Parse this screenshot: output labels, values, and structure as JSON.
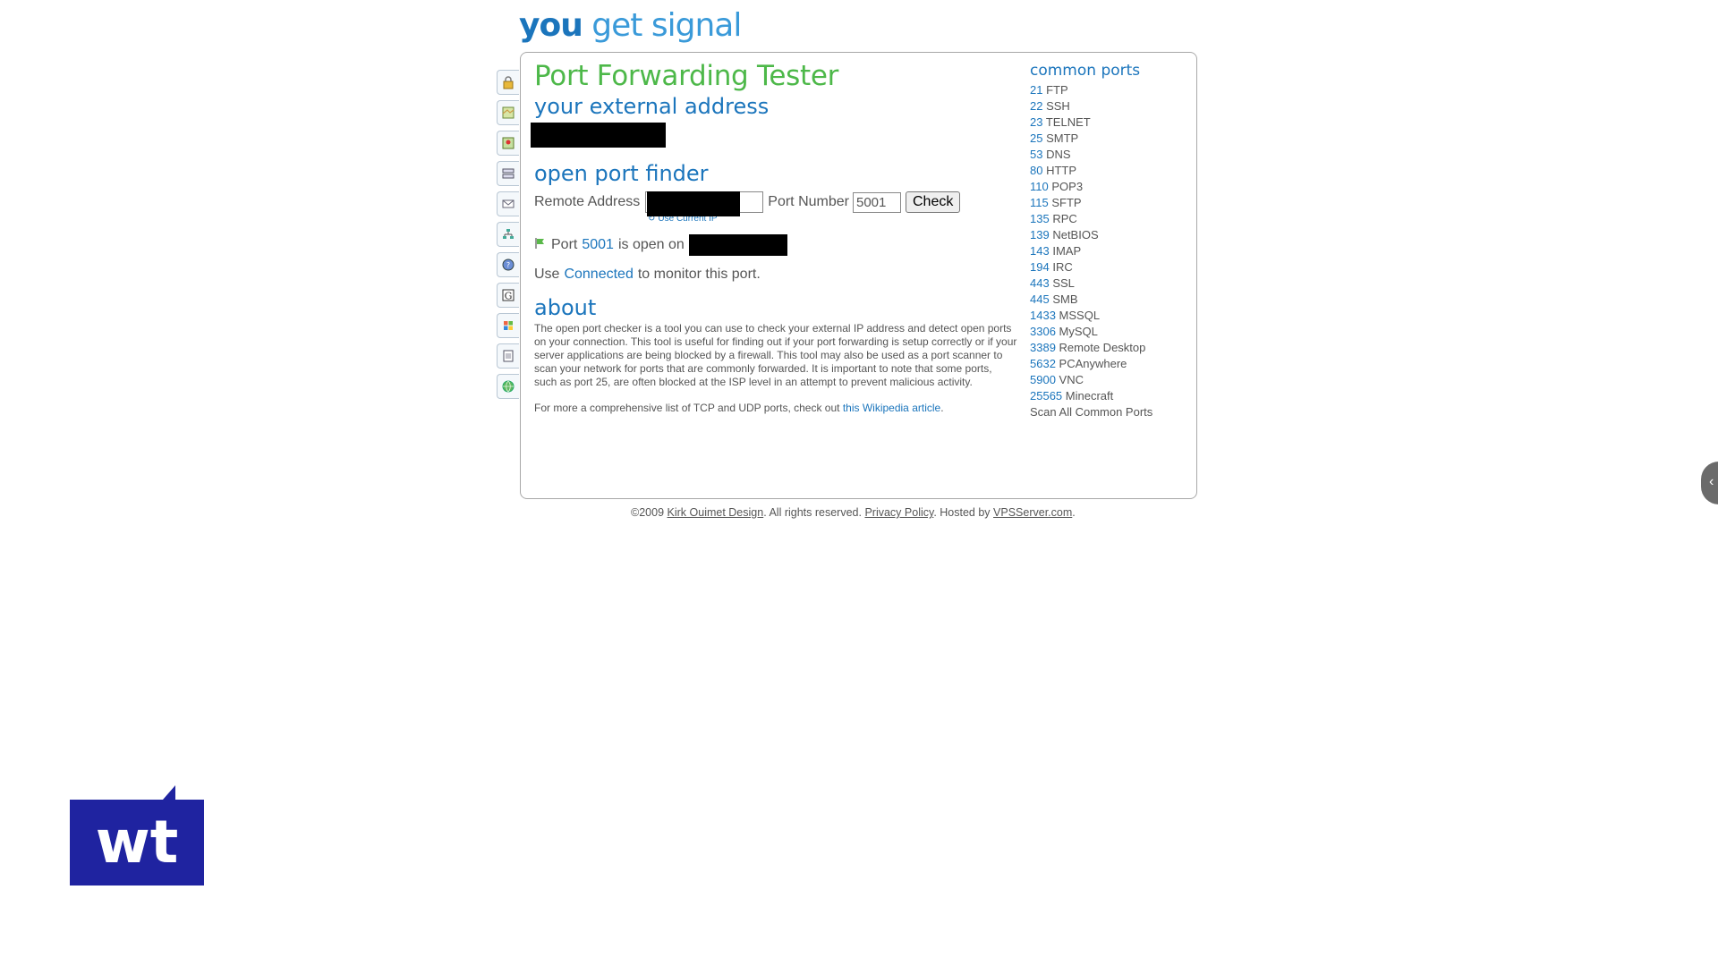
{
  "logo": {
    "part1": "you",
    "part2": "get signal"
  },
  "sidebar": {
    "icons": [
      "lock-icon",
      "map-icon",
      "map-location-icon",
      "server-icon",
      "mail-icon",
      "network-icon",
      "whois-icon",
      "google-icon",
      "windows-icon",
      "document-icon",
      "globe-icon"
    ]
  },
  "main": {
    "title": "Port Forwarding Tester",
    "external_heading": "your external address",
    "finder_heading": "open port finder",
    "remote_address_label": "Remote Address",
    "port_number_label": "Port Number",
    "port_number_value": "5001",
    "check_button": "Check",
    "use_current_ip": "Use Current IP",
    "result": {
      "prefix": "Port",
      "port": "5001",
      "suffix": "is open on"
    },
    "connected": {
      "prefix": "Use",
      "link": "Connected",
      "suffix": "to monitor this port."
    },
    "about_heading": "about",
    "about_text": "The open port checker is a tool you can use to check your external IP address and detect open ports on your connection. This tool is useful for finding out if your port forwarding is setup correctly or if your server applications are being blocked by a firewall. This tool may also be used as a port scanner to scan your network for ports that are commonly forwarded. It is important to note that some ports, such as port 25, are often blocked at the ISP level in an attempt to prevent malicious activity.",
    "more_prefix": "For more a comprehensive list of TCP and UDP ports, check out",
    "more_link": "this Wikipedia article",
    "more_suffix": "."
  },
  "common_ports": {
    "heading": "common ports",
    "items": [
      {
        "num": "21",
        "name": "FTP"
      },
      {
        "num": "22",
        "name": "SSH"
      },
      {
        "num": "23",
        "name": "TELNET"
      },
      {
        "num": "25",
        "name": "SMTP"
      },
      {
        "num": "53",
        "name": "DNS"
      },
      {
        "num": "80",
        "name": "HTTP"
      },
      {
        "num": "110",
        "name": "POP3"
      },
      {
        "num": "115",
        "name": "SFTP"
      },
      {
        "num": "135",
        "name": "RPC"
      },
      {
        "num": "139",
        "name": "NetBIOS"
      },
      {
        "num": "143",
        "name": "IMAP"
      },
      {
        "num": "194",
        "name": "IRC"
      },
      {
        "num": "443",
        "name": "SSL"
      },
      {
        "num": "445",
        "name": "SMB"
      },
      {
        "num": "1433",
        "name": "MSSQL"
      },
      {
        "num": "3306",
        "name": "MySQL"
      },
      {
        "num": "3389",
        "name": "Remote Desktop"
      },
      {
        "num": "5632",
        "name": "PCAnywhere"
      },
      {
        "num": "5900",
        "name": "VNC"
      },
      {
        "num": "25565",
        "name": "Minecraft"
      }
    ],
    "scan_all": "Scan All Common Ports"
  },
  "footer": {
    "copyright": "©2009",
    "kirk_link": "Kirk Ouimet Design",
    "rights": ". All rights reserved.",
    "privacy_link": "Privacy Policy",
    "hosted": ". Hosted by",
    "vps_link": "VPSServer.com",
    "end": "."
  },
  "wt_logo": {
    "text": "wt",
    "color": "#1f23a0"
  },
  "colors": {
    "title_green": "#4db849",
    "heading_blue": "#1b75bc"
  }
}
